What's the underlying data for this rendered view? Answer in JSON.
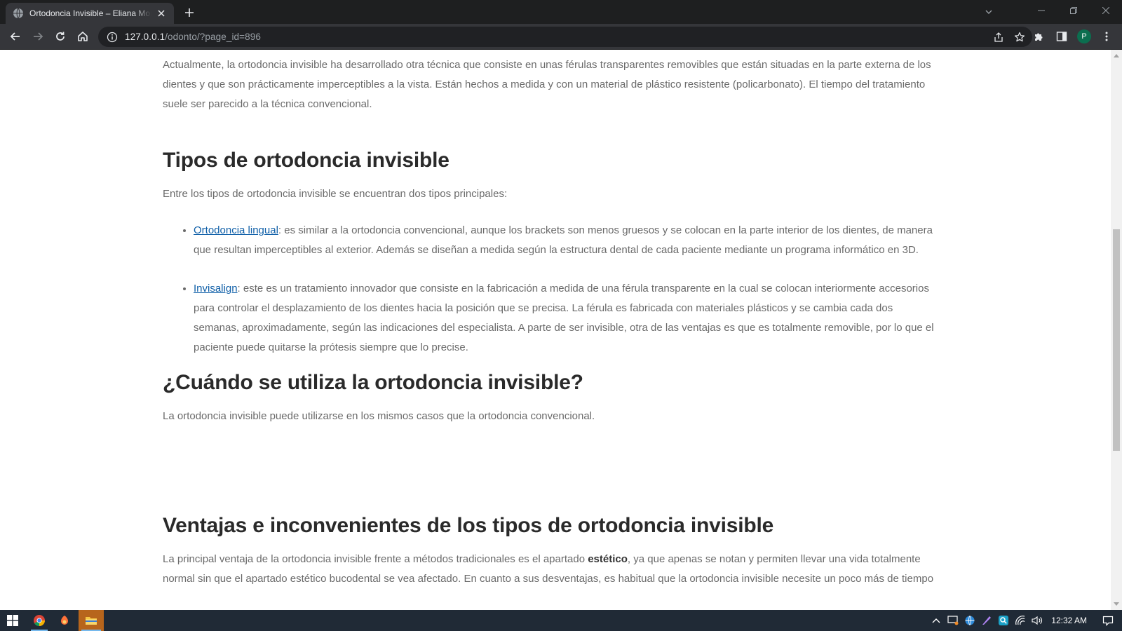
{
  "browser": {
    "tab_title": "Ortodoncia Invisible – Eliana Mor",
    "url_host": "127.0.0.1",
    "url_path": "/odonto/?page_id=896",
    "profile_initial": "P"
  },
  "article": {
    "intro": "Actualmente, la ortodoncia invisible ha desarrollado otra técnica que consiste en unas férulas transparentes removibles que están situadas en la parte externa de los dientes y que son prácticamente imperceptibles a la vista. Están hechos a medida y con un material de plástico resistente (policarbonato). El tiempo del tratamiento suele ser parecido a la técnica convencional.",
    "h_tipos": "Tipos de ortodoncia invisible",
    "tipos_intro": "Entre los tipos de ortodoncia invisible se encuentran dos tipos principales:",
    "item1_link": "Ortodoncia lingual",
    "item1_text": ": es similar a la ortodoncia convencional, aunque los brackets son menos gruesos y se colocan en la parte interior de los dientes, de manera que resultan imperceptibles al exterior. Además se diseñan a medida según la estructura dental de cada paciente mediante un programa informático en 3D.",
    "item2_link": "Invisalign",
    "item2_text": ": este es un tratamiento innovador que consiste en la fabricación a medida de una férula transparente en la cual se colocan interiormente accesorios para controlar el desplazamiento de los dientes hacia la posición que se precisa. La férula es fabricada con materiales plásticos y se cambia cada dos semanas, aproximadamente, según las indicaciones del especialista. A parte de ser invisible, otra de las ventajas es que es totalmente removible, por lo que el paciente puede quitarse la prótesis siempre que lo precise.",
    "h_cuando": "¿Cuándo se utiliza la ortodoncia invisible?",
    "cuando_text": "La ortodoncia invisible puede utilizarse en los mismos casos que la ortodoncia convencional.",
    "h_ventajas": "Ventajas e inconvenientes de los tipos de ortodoncia invisible",
    "ventajas_pre": "La principal ventaja de la ortodoncia invisible frente a métodos tradicionales es el apartado ",
    "ventajas_bold": "estético",
    "ventajas_post": ", ya que apenas se notan y permiten llevar una vida totalmente normal sin que el apartado estético bucodental se vea afectado. En cuanto a sus desventajas, es habitual que la ortodoncia invisible necesite un poco más de tiempo"
  },
  "taskbar": {
    "clock": "12:32 AM"
  },
  "colors": {
    "link": "#0f5fa8",
    "heading": "#2a2a2a",
    "body_text": "#6a6a6a",
    "taskbar": "#202a36"
  }
}
